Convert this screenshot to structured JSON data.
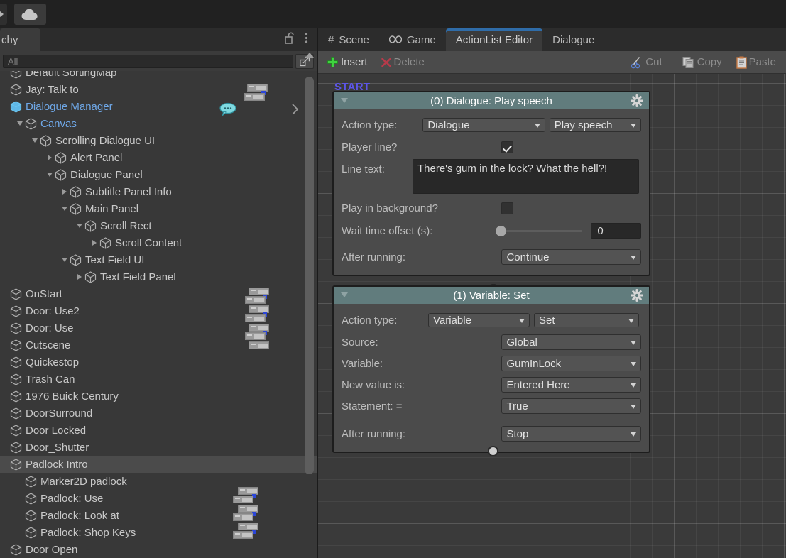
{
  "top_toolbar": {
    "cloud_icon": "cloud-icon",
    "dropdown_icon": "chevron-down-icon"
  },
  "hierarchy": {
    "tab_label": "chy",
    "lock_icon": "unlocked-padlock-icon",
    "menu_icon": "kebab-menu-icon",
    "search": {
      "value": "",
      "placeholder": "All"
    },
    "search_button_icon": "expand-arrow-icon",
    "items": [
      {
        "label": "Default SortingMap",
        "depth": 0,
        "twisty": "none",
        "state": "normal",
        "clipped": true
      },
      {
        "label": "Jay: Talk to",
        "depth": 0,
        "twisty": "none",
        "state": "normal"
      },
      {
        "label": "Dialogue Manager",
        "depth": 0,
        "twisty": "none",
        "state": "blue-selected-prefab"
      },
      {
        "label": "Canvas",
        "depth": 1,
        "twisty": "down",
        "state": "blue"
      },
      {
        "label": "Scrolling Dialogue UI",
        "depth": 2,
        "twisty": "down",
        "state": "normal"
      },
      {
        "label": "Alert Panel",
        "depth": 3,
        "twisty": "right",
        "state": "normal"
      },
      {
        "label": "Dialogue Panel",
        "depth": 3,
        "twisty": "down",
        "state": "normal"
      },
      {
        "label": "Subtitle Panel Info",
        "depth": 4,
        "twisty": "right",
        "state": "normal"
      },
      {
        "label": "Main Panel",
        "depth": 4,
        "twisty": "down",
        "state": "normal"
      },
      {
        "label": "Scroll Rect",
        "depth": 5,
        "twisty": "down",
        "state": "normal"
      },
      {
        "label": "Scroll Content",
        "depth": 6,
        "twisty": "right",
        "state": "normal"
      },
      {
        "label": "Text Field UI",
        "depth": 4,
        "twisty": "down",
        "state": "normal"
      },
      {
        "label": "Text Field Panel",
        "depth": 5,
        "twisty": "right",
        "state": "normal"
      },
      {
        "label": "OnStart",
        "depth": 0,
        "twisty": "none",
        "state": "normal"
      },
      {
        "label": "Door: Use2",
        "depth": 0,
        "twisty": "none",
        "state": "normal"
      },
      {
        "label": "Door: Use",
        "depth": 0,
        "twisty": "none",
        "state": "normal"
      },
      {
        "label": "Cutscene",
        "depth": 0,
        "twisty": "none",
        "state": "normal"
      },
      {
        "label": "Quickestop",
        "depth": 0,
        "twisty": "none",
        "state": "normal"
      },
      {
        "label": "Trash Can",
        "depth": 0,
        "twisty": "none",
        "state": "normal"
      },
      {
        "label": "1976 Buick Century",
        "depth": 0,
        "twisty": "none",
        "state": "normal"
      },
      {
        "label": "DoorSurround",
        "depth": 0,
        "twisty": "none",
        "state": "normal"
      },
      {
        "label": "Door Locked",
        "depth": 0,
        "twisty": "none",
        "state": "normal"
      },
      {
        "label": "Door_Shutter",
        "depth": 0,
        "twisty": "none",
        "state": "normal"
      },
      {
        "label": "Padlock Intro",
        "depth": 0,
        "twisty": "none",
        "state": "selected"
      },
      {
        "label": "Marker2D padlock",
        "depth": 1,
        "twisty": "none",
        "state": "normal"
      },
      {
        "label": "Padlock: Use",
        "depth": 1,
        "twisty": "none",
        "state": "normal"
      },
      {
        "label": "Padlock: Look at",
        "depth": 1,
        "twisty": "none",
        "state": "normal"
      },
      {
        "label": "Padlock: Shop Keys",
        "depth": 1,
        "twisty": "none",
        "state": "normal"
      },
      {
        "label": "Door Open",
        "depth": 0,
        "twisty": "none",
        "state": "normal"
      }
    ]
  },
  "editor": {
    "tabs": [
      {
        "label": "Scene",
        "icon": "grid-hash-icon",
        "active": false
      },
      {
        "label": "Game",
        "icon": "gamepad-icon",
        "active": false
      },
      {
        "label": "ActionList Editor",
        "icon": "",
        "active": true
      },
      {
        "label": "Dialogue",
        "icon": "",
        "active": false
      }
    ],
    "toolbar": [
      {
        "label": "Insert",
        "icon": "plus-icon",
        "enabled": true
      },
      {
        "label": "Delete",
        "icon": "cross-icon",
        "enabled": false
      },
      {
        "label": "Cut",
        "icon": "scissors-icon",
        "enabled": false
      },
      {
        "label": "Copy",
        "icon": "copy-documents-icon",
        "enabled": false
      },
      {
        "label": "Paste",
        "icon": "clipboard-icon",
        "enabled": false
      }
    ],
    "start_label": "START",
    "colors": {
      "node_header": "#617c7d",
      "node_body": "#4b4b4b",
      "start_text": "#5c55e8",
      "active_tab_underline": "#2f6ca8",
      "insert_icon": "#3fd33f",
      "delete_icon": "#b73a4a"
    },
    "nodes": [
      {
        "title": "(0) Dialogue: Play speech",
        "gear_icon": "gear-icon",
        "collapse_icon": "triangle-down-icon",
        "fields": [
          {
            "kind": "dual-dropdown",
            "label": "Action type:",
            "value1": "Dialogue",
            "value2": "Play speech"
          },
          {
            "kind": "checkbox",
            "label": "Player line?",
            "checked": true
          },
          {
            "kind": "textarea",
            "label": "Line text:",
            "value": "There's gum in the lock? What the hell?!"
          },
          {
            "kind": "checkbox",
            "label": "Play in background?",
            "checked": false
          },
          {
            "kind": "slider",
            "label": "Wait time offset (s):",
            "value": "0",
            "slider_pos": 0
          },
          {
            "kind": "dropdown",
            "label": "After running:",
            "value": "Continue"
          }
        ]
      },
      {
        "title": "(1) Variable: Set",
        "gear_icon": "gear-icon",
        "collapse_icon": "triangle-down-icon",
        "fields": [
          {
            "kind": "dual-dropdown",
            "label": "Action type:",
            "value1": "Variable",
            "value2": "Set"
          },
          {
            "kind": "dropdown",
            "label": "Source:",
            "value": "Global"
          },
          {
            "kind": "dropdown",
            "label": "Variable:",
            "value": "GumInLock"
          },
          {
            "kind": "dropdown",
            "label": "New value is:",
            "value": "Entered Here"
          },
          {
            "kind": "dropdown",
            "label": "Statement: =",
            "value": "True"
          },
          {
            "kind": "dropdown",
            "label": "After running:",
            "value": "Stop"
          }
        ]
      }
    ]
  }
}
